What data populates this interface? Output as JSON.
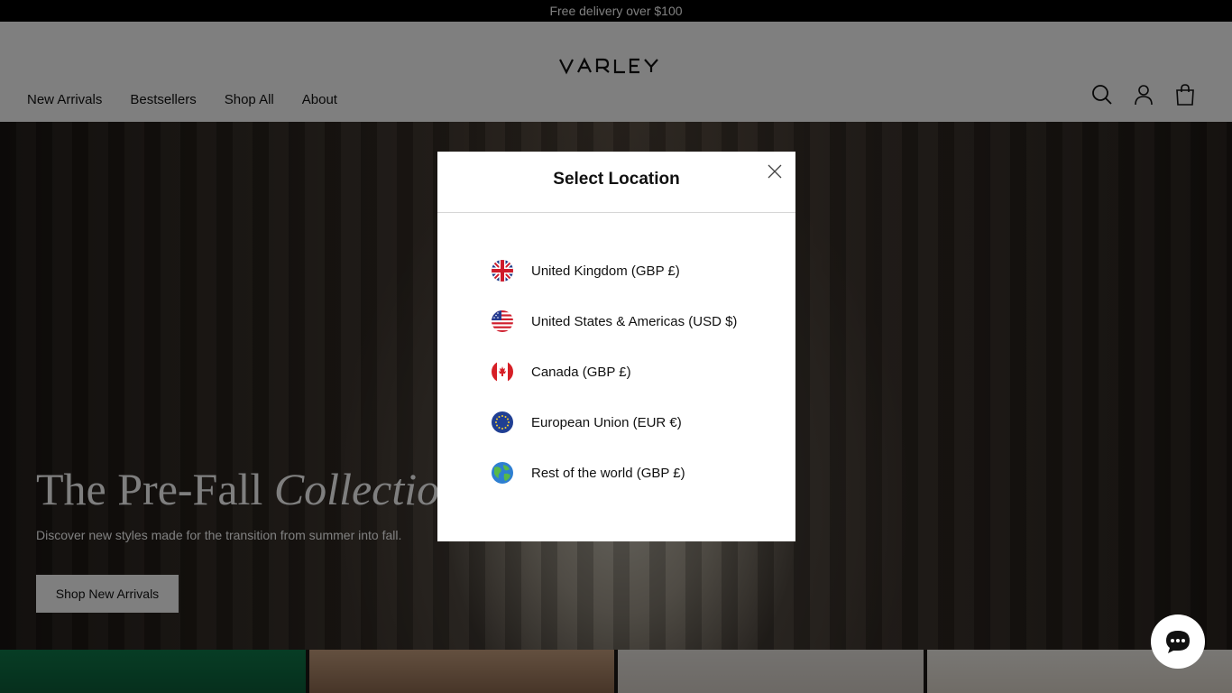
{
  "announcement": {
    "text": "Free delivery over $100"
  },
  "header": {
    "logo_text": "VARLEY",
    "nav": [
      "New Arrivals",
      "Bestsellers",
      "Shop All",
      "About"
    ],
    "icons": [
      "search-icon",
      "account-icon",
      "bag-icon"
    ]
  },
  "hero": {
    "title_plain": "The Pre-Fall ",
    "title_italic": "Collection",
    "subtitle": "Discover new styles made for the transition from summer into fall.",
    "button": "Shop New Arrivals"
  },
  "modal": {
    "title": "Select Location",
    "close_icon": "close-icon",
    "locations": [
      {
        "label": "United Kingdom (GBP £)",
        "flag": "uk-flag-icon"
      },
      {
        "label": "United States & Americas (USD $)",
        "flag": "us-flag-icon"
      },
      {
        "label": "Canada (GBP £)",
        "flag": "canada-flag-icon"
      },
      {
        "label": "European Union (EUR €)",
        "flag": "eu-flag-icon"
      },
      {
        "label": "Rest of the world (GBP £)",
        "flag": "globe-icon"
      }
    ]
  },
  "chat": {
    "icon": "chat-icon"
  },
  "colors": {
    "announcement_bg": "#000000",
    "button_bg": "#ffffff",
    "modal_bg": "#ffffff",
    "divider": "#d6d6d6"
  }
}
